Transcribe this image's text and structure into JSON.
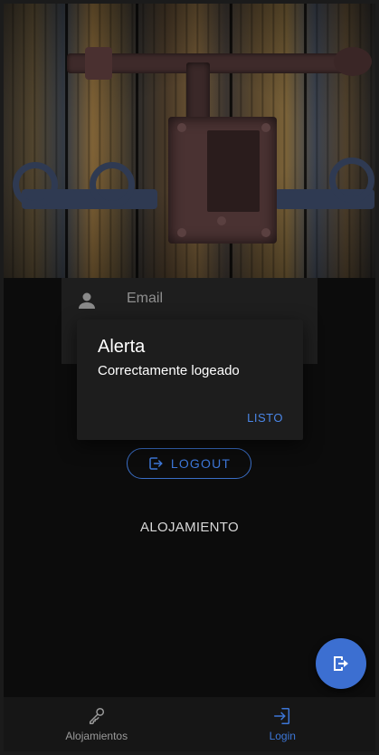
{
  "form": {
    "email_label": "Email"
  },
  "dialog": {
    "title": "Alerta",
    "message": "Correctamente logeado",
    "button_label": "LISTO"
  },
  "actions": {
    "logout_label": "LOGOUT"
  },
  "main": {
    "section_title": "ALOJAMIENTO"
  },
  "bottom_nav": {
    "items": [
      {
        "label": "Alojamientos",
        "icon": "key-icon",
        "active": false
      },
      {
        "label": "Login",
        "icon": "login-icon",
        "active": true
      }
    ]
  },
  "colors": {
    "accent": "#3d77d8",
    "background": "#0c0c0c",
    "dialog_background": "#1d1d1d",
    "nav_background": "#161616"
  }
}
